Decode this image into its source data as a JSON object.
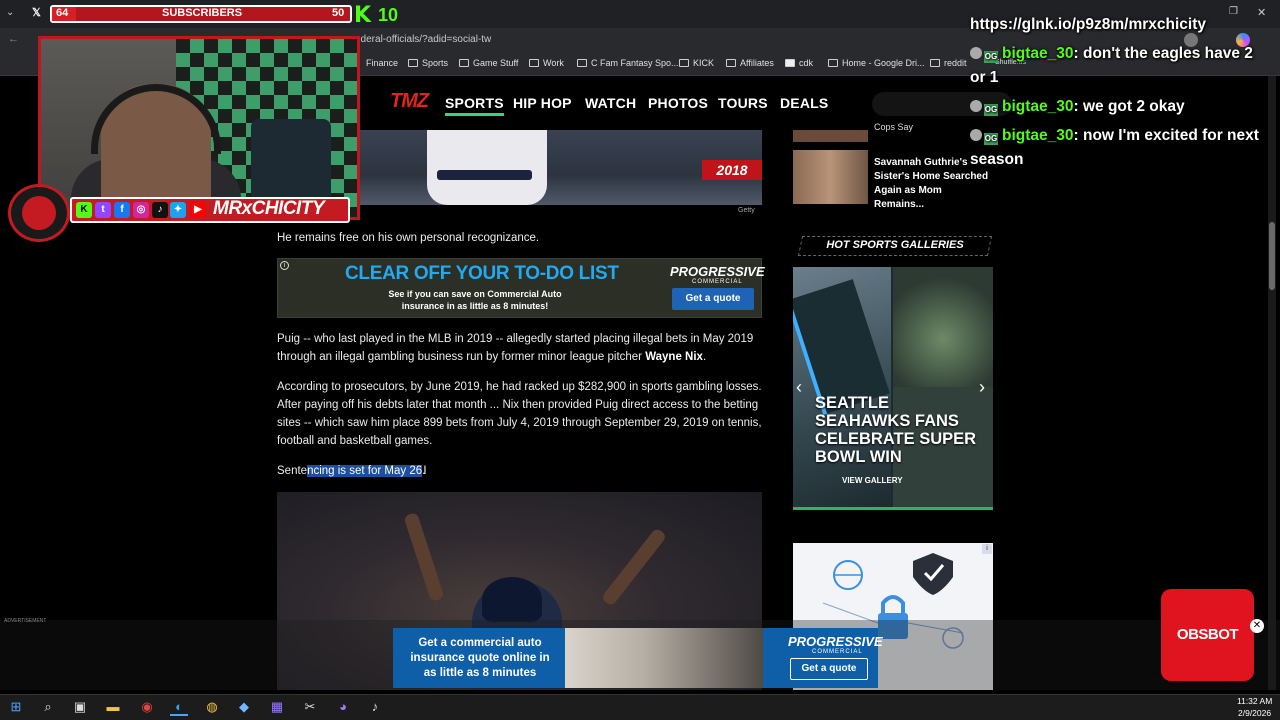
{
  "browser": {
    "url": "ederal-officials/?adid=social-tw",
    "bookmarks": [
      {
        "label": "Finance"
      },
      {
        "label": "Sports"
      },
      {
        "label": "Game Stuff"
      },
      {
        "label": "Work"
      },
      {
        "label": "C Fam Fantasy Spo..."
      },
      {
        "label": "KICK"
      },
      {
        "label": "Affiliates"
      },
      {
        "label": "cdk"
      },
      {
        "label": "Home - Google Dri..."
      },
      {
        "label": "reddit"
      },
      {
        "label": "Shuffle.us"
      }
    ]
  },
  "site": {
    "logo": "TMZ",
    "nav": [
      "SPORTS",
      "HIP HOP",
      "WATCH",
      "PHOTOS",
      "TOURS",
      "DEALS"
    ],
    "active_nav": "SPORTS"
  },
  "article": {
    "year_badge": "2018",
    "credit": "Getty",
    "p1": "He remains free on his own personal recognizance.",
    "p2_pre": "Puig -- who last played in the MLB in 2019 -- allegedly started placing illegal bets in May 2019 through an illegal gambling business run by former minor league pitcher ",
    "p2_bold": "Wayne Nix",
    "p2_post": ".",
    "p3": "According to prosecutors, by June 2019, he had racked up $282,900 in sports gambling losses. After paying off his debts later that month ... Nix then provided Puig direct access to the betting sites -- which saw him place 899 bets from July 4, 2019 through September 29, 2019 on tennis, football and basketball games.",
    "p4_pre": "Sente",
    "p4_sel": "ncing is set for May 26",
    "p4_post": "."
  },
  "ads": {
    "ad1_head": "CLEAR OFF YOUR TO-DO LIST",
    "ad1_sub": "See if you can save on Commercial Auto insurance in as little as 8 minutes!",
    "ad1_brand": "PROGRESSIVE",
    "ad1_brand_sub": "COMMERCIAL",
    "ad1_btn": "Get a quote",
    "ad3_text": "Get a commercial auto insurance quote online in as little as 8 minutes",
    "ad3_brand": "PROGRESSIVE",
    "ad3_brand_sub": "COMMERCIAL",
    "ad3_btn": "Get a quote",
    "strip_label": "ADVERTISEMENT"
  },
  "sidebar": {
    "item1": "Cops Say",
    "item2": "Savannah Guthrie's Sister's Home Searched Again as Mom Remains...",
    "gallery_head": "HOT SPORTS GALLERIES",
    "gallery_title": "SEATTLE SEAHAWKS FANS CELEBRATE SUPER BOWL WIN",
    "gallery_btn": "VIEW GALLERY"
  },
  "stream": {
    "sub_count": "64",
    "sub_label": "SUBSCRIBERS",
    "sub_goal": "50",
    "sub_progress": 0.08,
    "kick_icon": "K",
    "kick_count": "10",
    "cam_name": "MRxCHICITY",
    "chat": [
      {
        "user": "",
        "text": "https://glnk.io/p9z8m/mrxchicity"
      },
      {
        "user": "bigtae_30",
        "text": ": don't the eagles have 2 or 1"
      },
      {
        "user": "bigtae_30",
        "text": ": we got 2 okay"
      },
      {
        "user": "bigtae_30",
        "text": ": now I'm excited for next season"
      }
    ],
    "obsbot": "OBSBOT"
  },
  "taskbar": {
    "time": "11:32 AM",
    "date": "2/9/2026"
  },
  "colors": {
    "tmz_red": "#e02222",
    "stream_red": "#c41a21",
    "kick_green": "#53fc18",
    "progressive_blue": "#0e5ea8"
  }
}
